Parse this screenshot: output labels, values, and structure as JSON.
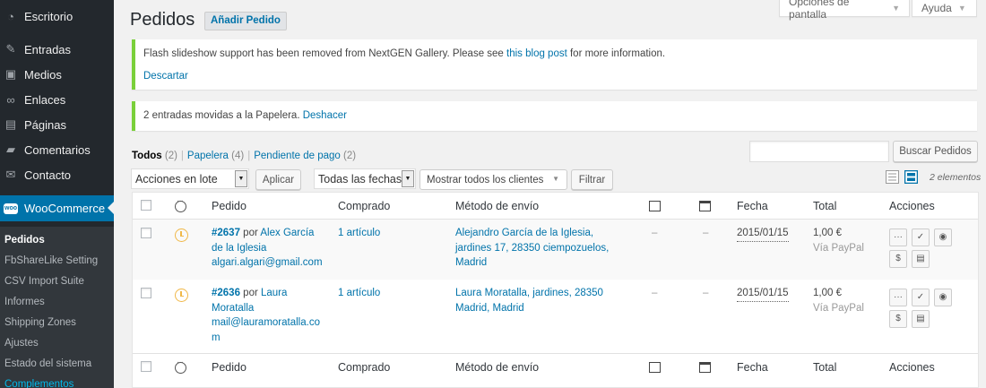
{
  "sidebar": {
    "items": [
      {
        "label": "Escritorio",
        "icon": "dashboard-icon"
      },
      {
        "label": "Entradas",
        "icon": "pushpin-icon"
      },
      {
        "label": "Medios",
        "icon": "media-icon"
      },
      {
        "label": "Enlaces",
        "icon": "link-icon"
      },
      {
        "label": "Páginas",
        "icon": "pages-icon"
      },
      {
        "label": "Comentarios",
        "icon": "comment-icon"
      },
      {
        "label": "Contacto",
        "icon": "mail-icon"
      },
      {
        "label": "WooCommerce",
        "icon": "woocommerce-icon"
      }
    ],
    "submenu": [
      "Pedidos",
      "FbShareLike Setting",
      "CSV Import Suite",
      "Informes",
      "Shipping Zones",
      "Ajustes",
      "Estado del sistema",
      "Complementos"
    ]
  },
  "top": {
    "screen_options": "Opciones de pantalla",
    "help": "Ayuda"
  },
  "page": {
    "title": "Pedidos",
    "add_button": "Añadir Pedido"
  },
  "notice1": {
    "text_before": "Flash slideshow support has been removed from NextGEN Gallery. Please see ",
    "link": "this blog post",
    "text_after": " for more information.",
    "dismiss": "Descartar"
  },
  "notice2": {
    "text": "2 entradas movidas a la Papelera. ",
    "undo": "Deshacer"
  },
  "filters": {
    "all": "Todos",
    "all_count": "(2)",
    "trash": "Papelera",
    "trash_count": "(4)",
    "pending": "Pendiente de pago",
    "pending_count": "(2)",
    "bulk_selected": "Acciones en lote",
    "apply": "Aplicar",
    "dates_selected": "Todas las fechas",
    "customers_selected": "Mostrar todos los clientes",
    "filter": "Filtrar",
    "search_button": "Buscar Pedidos",
    "search_value": "",
    "items_count": "2 elementos"
  },
  "table": {
    "columns": {
      "order": "Pedido",
      "purchased": "Comprado",
      "shipping": "Método de envío",
      "date": "Fecha",
      "total": "Total",
      "actions": "Acciones"
    },
    "rows": [
      {
        "number": "#2637",
        "by": " por ",
        "name_line1": "Alex García",
        "name_line2": "de la Iglesia",
        "email": "algari.algari@gmail.com",
        "items": "1 artículo",
        "address_lines": [
          "Alejandro García de la Iglesia,",
          "jardines 17, 28350 ciempozuelos,",
          "Madrid"
        ],
        "notes1": "–",
        "notes2": "–",
        "date": "2015/01/15",
        "total": "1,00 €",
        "via": "Vía PayPal"
      },
      {
        "number": "#2636",
        "by": " por ",
        "name_line1": "Laura",
        "name_line2": "Moratalla",
        "email_line1": "mail@lauramoratalla.co",
        "email_line2": "m",
        "items": "1 artículo",
        "address_lines": [
          "Laura Moratalla, jardines, 28350",
          "Madrid, Madrid"
        ],
        "notes1": "–",
        "notes2": "–",
        "date": "2015/01/15",
        "total": "1,00 €",
        "via": "Vía PayPal"
      }
    ]
  },
  "colors": {
    "sidebar_bg": "#23282d",
    "accent": "#0073aa",
    "notice_green": "#7ad03a",
    "pending_orange": "#f0b849"
  }
}
